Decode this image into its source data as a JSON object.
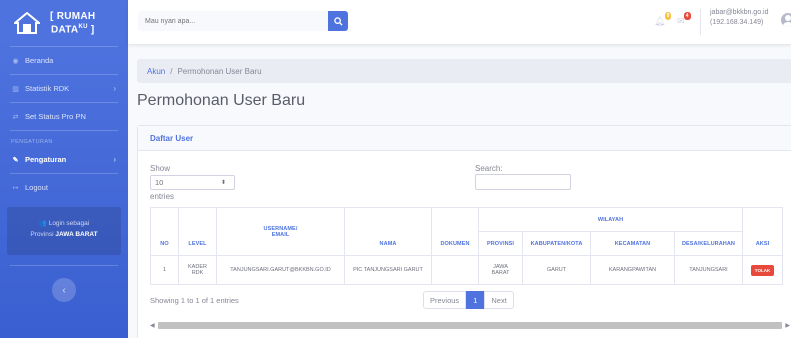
{
  "sidebar": {
    "brand_line1": "[ RUMAH",
    "brand_line2": "DATA",
    "brand_sup": "KU",
    "brand_close": " ]",
    "items": [
      {
        "label": "Beranda",
        "icon": "palette-icon"
      },
      {
        "label": "Statistik RDK",
        "icon": "chart-icon"
      },
      {
        "label": "Set Status Pro PN",
        "icon": "swap-icon"
      }
    ],
    "heading": "PENGATURAN",
    "settings_label": "Pengaturan",
    "logout_label": "Logout",
    "login_as": "Login sebagai",
    "login_prov_prefix": "Provinsi ",
    "login_prov": "JAWA BARAT",
    "accent": "#4e73df"
  },
  "topbar": {
    "search_placeholder": "Mau nyari apa...",
    "alerts_badge": "9",
    "messages_badge": "4",
    "user_email": "jabar@bkkbn.go.id",
    "user_ip": "(192.168.34.149)"
  },
  "breadcrumb": {
    "parent": "Akun",
    "separator": "/",
    "current": "Permohonan User Baru"
  },
  "page_title": "Permohonan User Baru",
  "card": {
    "title": "Daftar User",
    "show_label": "Show",
    "entries_value": "10",
    "entries_label": "entries",
    "search_label": "Search:"
  },
  "table": {
    "group_header": "WILAYAH",
    "headers": {
      "no": "NO",
      "level": "LEVEL",
      "username_line1": "USERNAME/",
      "username_line2": "EMAIL",
      "nama": "NAMA",
      "dokumen": "DOKUMEN",
      "provinsi": "PROVINSI",
      "kabupaten": "KABUPATEN/KOTA",
      "kecamatan": "KECAMATAN",
      "desa": "DESA/KELURAHAN",
      "aksi": "AKSI"
    },
    "rows": [
      {
        "no": "1",
        "level_line1": "KADER",
        "level_line2": "RDK",
        "username": "TANJUNGSARI.GARUT@BKKBN.GO.ID",
        "nama": "PIC TANJUNGSARI GARUT",
        "dokumen": "",
        "provinsi_line1": "JAWA",
        "provinsi_line2": "BARAT",
        "kabupaten": "GARUT",
        "kecamatan": "KARANGPAWITAN",
        "desa": "TANJUNGSARI",
        "aksi": "TOLAK"
      }
    ]
  },
  "footer": {
    "info": "Showing 1 to 1 of 1 entries",
    "previous": "Previous",
    "page": "1",
    "next": "Next"
  }
}
